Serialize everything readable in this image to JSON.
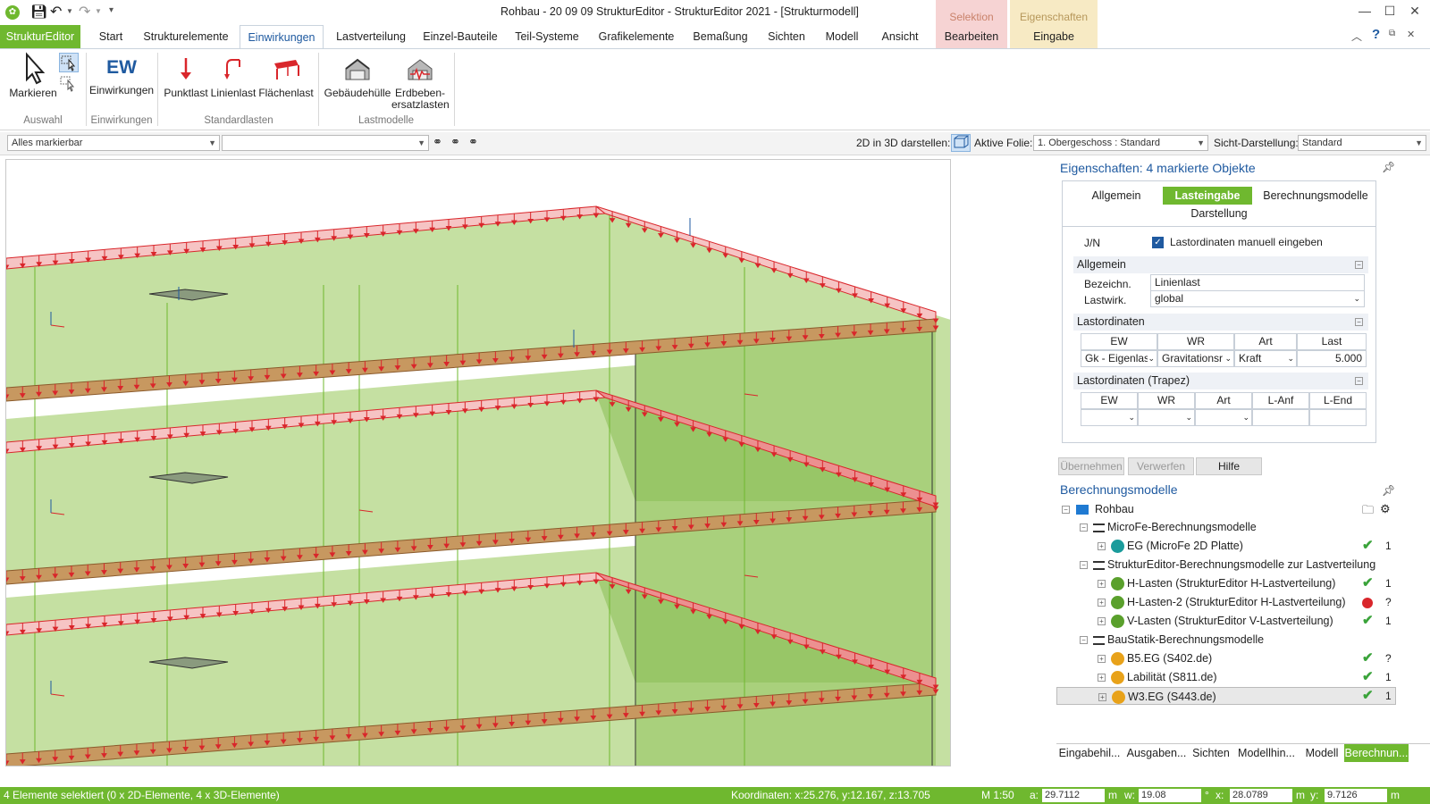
{
  "window": {
    "title": "Rohbau - 20 09 09 StrukturEditor - StrukturEditor 2021 - [Strukturmodell]",
    "context_selection": "Selektion",
    "context_properties": "Eigenschaften"
  },
  "app_button": "StrukturEditor",
  "tabs": [
    "Start",
    "Strukturelemente",
    "Einwirkungen",
    "Lastverteilung",
    "Einzel-Bauteile",
    "Teil-Systeme",
    "Grafikelemente",
    "Bemaßung",
    "Sichten",
    "Modell",
    "Ansicht",
    "Bearbeiten",
    "Eingabe"
  ],
  "ribbon": {
    "markieren": "Markieren",
    "ew_icon": "EW",
    "einwirkungen": "Einwirkungen",
    "punktlast": "Punktlast",
    "linienlast": "Linienlast",
    "flaechenlast": "Flächenlast",
    "gebaeudehuelle": "Gebäudehülle",
    "erdbeben_1": "Erdbeben-",
    "erdbeben_2": "ersatzlasten",
    "grp_auswahl": "Auswahl",
    "grp_einwirkungen": "Einwirkungen",
    "grp_standardlasten": "Standardlasten",
    "grp_lastmodelle": "Lastmodelle"
  },
  "toolbar": {
    "filter_value": "Alles markierbar",
    "second_value": "",
    "label_2d3d": "2D in 3D darstellen:",
    "label_folie": "Aktive Folie:",
    "folie_value": "1. Obergeschoss : Standard",
    "label_sicht": "Sicht-Darstellung:",
    "sicht_value": "Standard"
  },
  "properties": {
    "title": "Eigenschaften: 4 markierte Objekte",
    "tab_allgemein": "Allgemein",
    "tab_lasteingabe": "Lasteingabe",
    "tab_berechnung": "Berechnungsmodelle",
    "tab_darstellung": "Darstellung",
    "jn": "J/N",
    "manual_label": "Lastordinaten manuell eingeben",
    "sec_allgemein": "Allgemein",
    "bezeichn_label": "Bezeichn.",
    "bezeichn_value": "Linienlast",
    "lastwirk_label": "Lastwirk.",
    "lastwirk_value": "global",
    "sec_lastordinaten": "Lastordinaten",
    "lo_headers": [
      "EW",
      "WR",
      "Art",
      "Last"
    ],
    "lo_row": [
      "Gk - Eigenlas",
      "Gravitationsr",
      "Kraft",
      "5.000"
    ],
    "sec_trapez": "Lastordinaten (Trapez)",
    "tr_headers": [
      "EW",
      "WR",
      "Art",
      "L-Anf",
      "L-End"
    ],
    "btn_uebernehmen": "Übernehmen",
    "btn_verwerfen": "Verwerfen",
    "btn_hilfe": "Hilfe"
  },
  "models": {
    "title": "Berechnungsmodelle",
    "root": "Rohbau",
    "items": [
      {
        "label": "MicroFe-Berechnungsmodelle",
        "level": 1,
        "status": "",
        "count": ""
      },
      {
        "label": "EG (MicroFe 2D Platte)",
        "level": 2,
        "status": "ok",
        "count": "1"
      },
      {
        "label": "StrukturEditor-Berechnungsmodelle zur Lastverteilung",
        "level": 1,
        "status": "",
        "count": ""
      },
      {
        "label": "H-Lasten (StrukturEditor H-Lastverteilung)",
        "level": 2,
        "status": "ok",
        "count": "1"
      },
      {
        "label": "H-Lasten-2 (StrukturEditor H-Lastverteilung)",
        "level": 2,
        "status": "err",
        "count": "?"
      },
      {
        "label": "V-Lasten (StrukturEditor V-Lastverteilung)",
        "level": 2,
        "status": "ok",
        "count": "1"
      },
      {
        "label": "BauStatik-Berechnungsmodelle",
        "level": 1,
        "status": "",
        "count": ""
      },
      {
        "label": "B5.EG (S402.de)",
        "level": 2,
        "status": "ok",
        "count": "?"
      },
      {
        "label": "Labilität (S811.de)",
        "level": 2,
        "status": "ok",
        "count": "1"
      },
      {
        "label": "W3.EG (S443.de)",
        "level": 2,
        "status": "ok",
        "count": "1"
      }
    ]
  },
  "bottom_tabs": [
    "Eingabehil...",
    "Ausgaben...",
    "Sichten",
    "Modellhin...",
    "Modell",
    "Berechnun..."
  ],
  "status": {
    "selection": "4 Elemente selektiert (0 x 2D-Elemente, 4 x 3D-Elemente)",
    "coords": "Koordinaten: x:25.276, y:12.167, z:13.705",
    "scale": "M 1:50",
    "a_label": "a:",
    "a_value": "29.7112",
    "m1": "m",
    "w_label": "w:",
    "w_value": "19.08",
    "deg": "°",
    "x_label": "x:",
    "x_value": "28.0789",
    "m2": "m",
    "y_label": "y:",
    "y_value": "9.7126",
    "m3": "m"
  },
  "colors": {
    "accent": "#6fb82f",
    "blue": "#1f5aa0",
    "wall": "#b5d88a",
    "load": "#e8454a"
  }
}
